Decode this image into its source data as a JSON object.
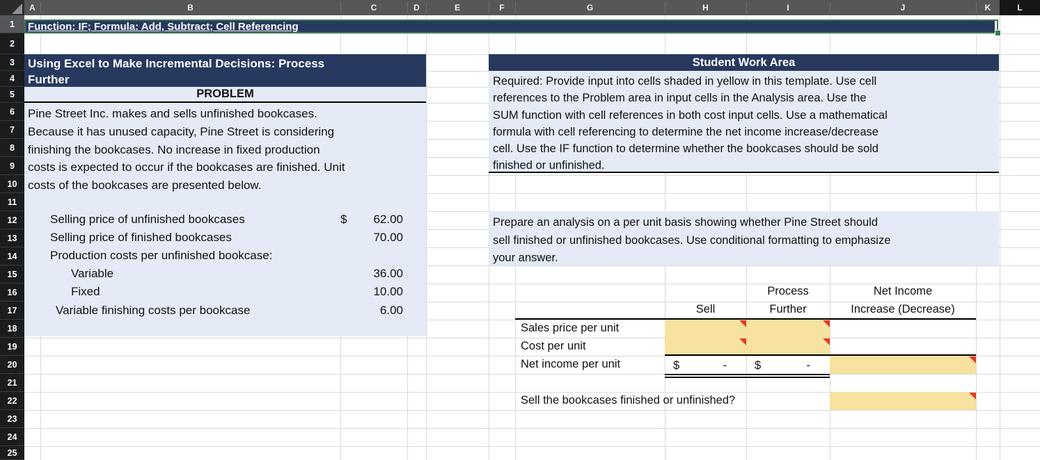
{
  "colors": {
    "banner_navy": "#27395F",
    "panel_blue": "#E4EBF6",
    "input_yellow": "#F8E2A0",
    "comment_red": "#E5392E",
    "selection_green": "#3B7D4F"
  },
  "sheet": {
    "column_letters": [
      "A",
      "B",
      "C",
      "D",
      "E",
      "F",
      "G",
      "H",
      "I",
      "J",
      "K",
      "L"
    ],
    "row_numbers": [
      "1",
      "2",
      "3",
      "4",
      "5",
      "6",
      "7",
      "8",
      "9",
      "10",
      "11",
      "12",
      "13",
      "14",
      "15",
      "16",
      "17",
      "18",
      "19",
      "20",
      "21",
      "22",
      "23",
      "24",
      "25"
    ]
  },
  "title_cell": {
    "text": "Function: IF; Formula: Add, Subtract; Cell Referencing"
  },
  "problem": {
    "header": "Using Excel to Make Incremental Decisions: Process\nFurther",
    "section_label": "PROBLEM",
    "body": "Pine Street Inc. makes and sells unfinished bookcases.\nBecause it has unused capacity, Pine Street is considering\nfinishing the bookcases. No increase in fixed production\ncosts is expected to occur if the bookcases are finished. Unit\ncosts of the bookcases are presented below.",
    "items": [
      {
        "label": "Selling price of unfinished bookcases",
        "currency": "$",
        "value": "62.00"
      },
      {
        "label": "Selling price of finished bookcases",
        "currency": "",
        "value": "70.00"
      },
      {
        "label": "Production costs per unfinished bookcase:",
        "currency": "",
        "value": ""
      },
      {
        "label": "Variable",
        "currency": "",
        "value": "36.00"
      },
      {
        "label": "Fixed",
        "currency": "",
        "value": "10.00"
      },
      {
        "label": "Variable finishing costs per bookcase",
        "currency": "",
        "value": "6.00"
      }
    ]
  },
  "student_work_area": {
    "header": "Student Work Area",
    "required_text": "Required: Provide input into cells shaded in yellow in this template. Use cell\nreferences to the Problem area in input cells in the Analysis area. Use the\nSUM function with cell references in both cost input cells. Use a mathematical\nformula with cell referencing to determine the net income increase/decrease\ncell. Use the IF function to determine whether the bookcases should be sold\nfinished or unfinished.",
    "prepare_text": "Prepare an analysis on a per unit basis showing whether Pine Street should\nsell finished or unfinished bookcases. Use conditional formatting to emphasize\nyour answer."
  },
  "analysis": {
    "headers": {
      "sell": "Sell",
      "process_top": "Process",
      "process_bottom": "Further",
      "net_income_top": "Net Income",
      "net_income_bottom": "Increase (Decrease)"
    },
    "row_labels": {
      "sales_price": "Sales price per unit",
      "cost": "Cost per unit",
      "net_income": "Net income per unit"
    },
    "net_income_row": {
      "sell_currency": "$",
      "sell_value": "-",
      "process_currency": "$",
      "process_value": "-"
    },
    "question": "Sell the bookcases finished or unfinished?"
  }
}
